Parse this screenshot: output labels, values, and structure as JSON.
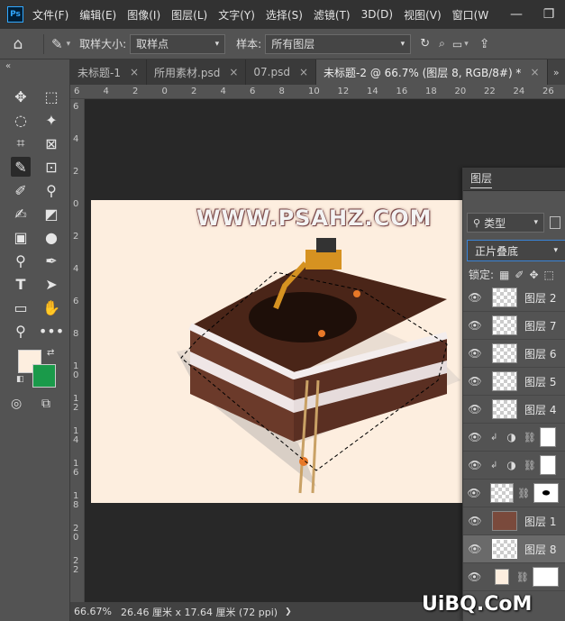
{
  "menubar": {
    "logo": "Ps",
    "items": [
      "文件(F)",
      "编辑(E)",
      "图像(I)",
      "图层(L)",
      "文字(Y)",
      "选择(S)",
      "滤镜(T)",
      "3D(D)",
      "视图(V)",
      "窗口(W"
    ]
  },
  "options": {
    "sample_size_label": "取样大小:",
    "sample_size_value": "取样点",
    "sample_label": "样本:",
    "sample_value": "所有图层"
  },
  "tabs": [
    {
      "label": "未标题-1",
      "active": false
    },
    {
      "label": "所用素材.psd",
      "active": false
    },
    {
      "label": "07.psd",
      "active": false
    },
    {
      "label": "未标题-2 @ 66.7% (图层 8, RGB/8#) *",
      "active": true
    }
  ],
  "ruler_h": [
    "6",
    "4",
    "2",
    "0",
    "2",
    "4",
    "6",
    "8",
    "10",
    "12",
    "14",
    "16",
    "18",
    "20",
    "22",
    "24",
    "26"
  ],
  "ruler_v": [
    "6",
    "4",
    "2",
    "0",
    "2",
    "4",
    "6",
    "8",
    "1 0",
    "1 2",
    "1 4",
    "1 6",
    "1 8",
    "2 0",
    "2 2"
  ],
  "canvas": {
    "watermark": "WWW.PSAHZ.COM",
    "background_color": "#fdeedf"
  },
  "colors": {
    "foreground": "#fdeedf",
    "background": "#1a9a4a"
  },
  "status": {
    "zoom": "66.67%",
    "doc_info": "26.46 厘米 x 17.64 厘米 (72 ppi)",
    "arrow": "❯"
  },
  "layers_panel": {
    "title": "图层",
    "filter_label": "类型",
    "blend_mode": "正片叠底",
    "lock_label": "锁定:",
    "layers": [
      {
        "name": "图层 2",
        "selected": false
      },
      {
        "name": "图层 7",
        "selected": false
      },
      {
        "name": "图层 6",
        "selected": false
      },
      {
        "name": "图层 5",
        "selected": false
      },
      {
        "name": "图层 4",
        "selected": false
      },
      {
        "name": "",
        "selected": false
      },
      {
        "name": "",
        "selected": false
      },
      {
        "name": "",
        "selected": false
      },
      {
        "name": "图层 1",
        "selected": false
      },
      {
        "name": "图层 8",
        "selected": true
      },
      {
        "name": "",
        "selected": false
      }
    ]
  },
  "site_watermark": "UiBQ.CoM"
}
